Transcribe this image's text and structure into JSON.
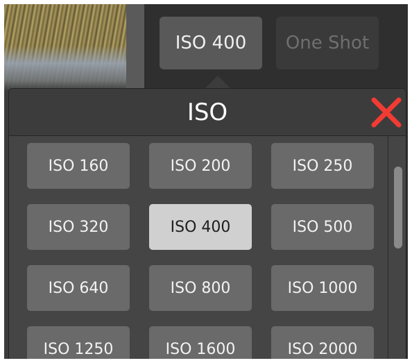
{
  "top_bar": {
    "iso_button_label": "ISO 400",
    "drive_mode_label": "One Shot"
  },
  "popover": {
    "title": "ISO",
    "close_icon": "close-x-icon",
    "close_color": "#f23b33",
    "selected_value": "ISO 400",
    "options": [
      "ISO 160",
      "ISO 200",
      "ISO 250",
      "ISO 320",
      "ISO 400",
      "ISO 500",
      "ISO 640",
      "ISO 800",
      "ISO 1000",
      "ISO 1250",
      "ISO 1600",
      "ISO 2000"
    ]
  }
}
